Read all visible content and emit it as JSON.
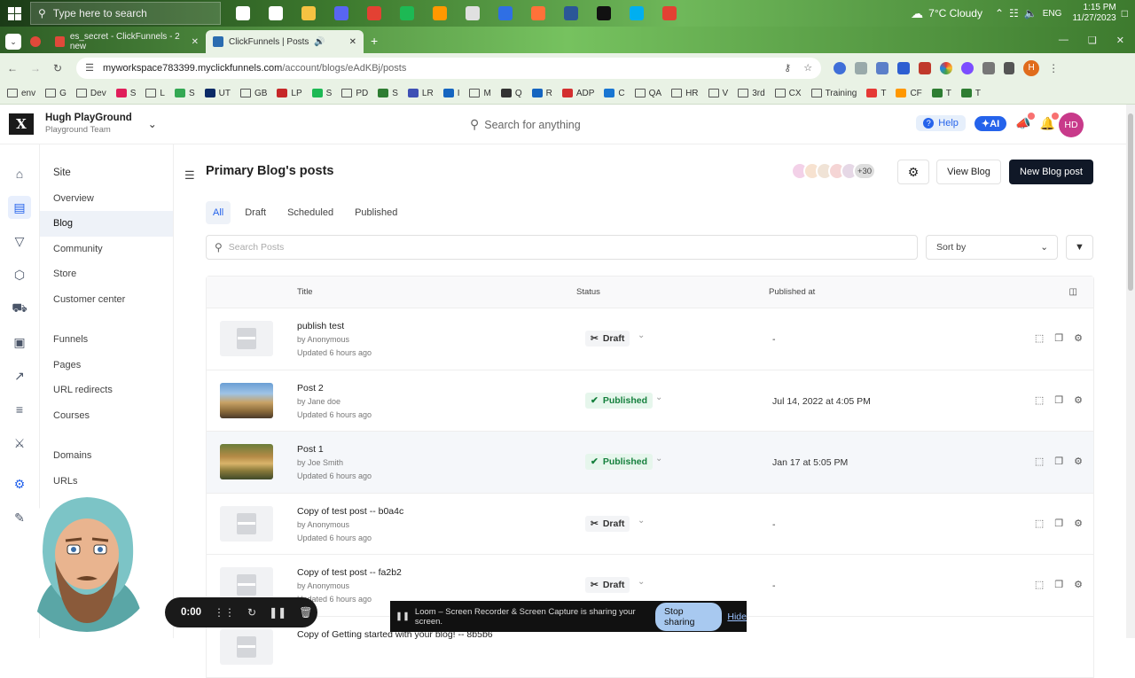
{
  "taskbar": {
    "search_placeholder": "Type here to search",
    "weather": "7°C  Cloudy",
    "lang": "ENG",
    "time": "1:15 PM",
    "date": "11/27/2023",
    "apps": [
      {
        "icon": "task-view-icon",
        "color": "#ffffff"
      },
      {
        "icon": "settings-icon",
        "color": "#ffffff"
      },
      {
        "icon": "file-explorer-icon",
        "color": "#f5c242"
      },
      {
        "icon": "discord-icon",
        "color": "#5865f2"
      },
      {
        "icon": "chrome-icon",
        "color": "#e34133"
      },
      {
        "icon": "spotify-icon",
        "color": "#1db954"
      },
      {
        "icon": "sublime-icon",
        "color": "#ff9800"
      },
      {
        "icon": "notepad-icon",
        "color": "#e0e0e0"
      },
      {
        "icon": "vpn-icon",
        "color": "#2f6fe4"
      },
      {
        "icon": "firefox-icon",
        "color": "#ff7139"
      },
      {
        "icon": "powershell-icon",
        "color": "#2b5797"
      },
      {
        "icon": "terminal-icon",
        "color": "#111111"
      },
      {
        "icon": "skype-icon",
        "color": "#00aff0"
      },
      {
        "icon": "chrome-profile-icon",
        "color": "#e34133"
      }
    ]
  },
  "browser": {
    "tabs": [
      {
        "label": "es_secret - ClickFunnels - 2 new",
        "color": "#e0493a",
        "active": false
      },
      {
        "label": "ClickFunnels | Posts",
        "color": "#2b6cb0",
        "active": true
      }
    ],
    "url_host": "myworkspace783399.myclickfunnels.com",
    "url_path": "/account/blogs/eAdKBj/posts",
    "profile_initial": "H",
    "bookmarks": [
      {
        "label": "env",
        "color": ""
      },
      {
        "label": "G",
        "color": ""
      },
      {
        "label": "Dev",
        "color": ""
      },
      {
        "label": "S",
        "color": "#e01e5a"
      },
      {
        "label": "L",
        "color": ""
      },
      {
        "label": "S",
        "color": "#34a853"
      },
      {
        "label": "UT",
        "color": "#0a2a66"
      },
      {
        "label": "GB",
        "color": ""
      },
      {
        "label": "LP",
        "color": "#c62828"
      },
      {
        "label": "S",
        "color": "#1db954"
      },
      {
        "label": "PD",
        "color": ""
      },
      {
        "label": "S",
        "color": "#2e7d32"
      },
      {
        "label": "LR",
        "color": "#3f51b5"
      },
      {
        "label": "I",
        "color": "#1565c0"
      },
      {
        "label": "M",
        "color": ""
      },
      {
        "label": "Q",
        "color": "#333333"
      },
      {
        "label": "R",
        "color": "#1565c0"
      },
      {
        "label": "ADP",
        "color": "#d32f2f"
      },
      {
        "label": "C",
        "color": "#1976d2"
      },
      {
        "label": "QA",
        "color": ""
      },
      {
        "label": "HR",
        "color": ""
      },
      {
        "label": "V",
        "color": ""
      },
      {
        "label": "3rd",
        "color": ""
      },
      {
        "label": "CX",
        "color": ""
      },
      {
        "label": "Training",
        "color": ""
      },
      {
        "label": "T",
        "color": "#e53935"
      },
      {
        "label": "CF",
        "color": "#ff9800"
      },
      {
        "label": "T",
        "color": "#2e7d32"
      },
      {
        "label": "T",
        "color": "#2e7d32"
      }
    ]
  },
  "app": {
    "workspace_name": "Hugh PlayGround",
    "workspace_team": "Playground Team",
    "search_placeholder": "Search for anything",
    "help_label": "Help",
    "ai_label": "AI",
    "user_initials": "HD",
    "accent": "#2563eb",
    "rail_icons": [
      "home-icon",
      "websites-icon",
      "funnels-icon",
      "products-icon",
      "orders-icon",
      "contacts-icon",
      "analytics-icon",
      "automations-icon",
      "courses-icon",
      "settings-icon",
      "edit-icon"
    ],
    "nav": [
      {
        "label": "Site",
        "type": "head"
      },
      {
        "label": "Overview",
        "type": "item"
      },
      {
        "label": "Blog",
        "type": "active"
      },
      {
        "label": "Community",
        "type": "item"
      },
      {
        "label": "Store",
        "type": "item"
      },
      {
        "label": "Customer center",
        "type": "item"
      },
      {
        "label": "",
        "type": "gap"
      },
      {
        "label": "Funnels",
        "type": "item"
      },
      {
        "label": "Pages",
        "type": "item"
      },
      {
        "label": "URL redirects",
        "type": "item"
      },
      {
        "label": "Courses",
        "type": "item"
      },
      {
        "label": "",
        "type": "gap"
      },
      {
        "label": "Domains",
        "type": "item"
      },
      {
        "label": "URLs",
        "type": "item"
      }
    ]
  },
  "page": {
    "title": "Primary Blog's posts",
    "collaborators_more": "+30",
    "view_blog_label": "View Blog",
    "new_post_label": "New Blog post",
    "filter_tabs": [
      {
        "label": "All",
        "active": true
      },
      {
        "label": "Draft",
        "active": false
      },
      {
        "label": "Scheduled",
        "active": false
      },
      {
        "label": "Published",
        "active": false
      }
    ],
    "search_placeholder": "Search Posts",
    "sort_label": "Sort by",
    "columns": {
      "title": "Title",
      "status": "Status",
      "published_at": "Published at"
    },
    "posts": [
      {
        "title": "publish test",
        "author": "by Anonymous",
        "updated": "Updated 6 hours ago",
        "status": "Draft",
        "published_at": "-",
        "thumb": "placeholder"
      },
      {
        "title": "Post 2",
        "author": "by Jane doe",
        "updated": "Updated 6 hours ago",
        "status": "Published",
        "published_at": "Jul 14, 2022 at 4:05 PM",
        "thumb": "photo-columns"
      },
      {
        "title": "Post 1",
        "author": "by Joe Smith",
        "updated": "Updated 6 hours ago",
        "status": "Published",
        "published_at": "Jan 17 at 5:05 PM",
        "thumb": "photo-forest"
      },
      {
        "title": "Copy of test post -- b0a4c",
        "author": "by Anonymous",
        "updated": "Updated 6 hours ago",
        "status": "Draft",
        "published_at": "-",
        "thumb": "placeholder"
      },
      {
        "title": "Copy of test post -- fa2b2",
        "author": "by Anonymous",
        "updated": "Updated 6 hours ago",
        "status": "Draft",
        "published_at": "-",
        "thumb": "placeholder"
      },
      {
        "title": "Copy of Getting started with your blog! -- 8b5b6",
        "author": "",
        "updated": "",
        "status": "",
        "published_at": "",
        "thumb": "placeholder"
      }
    ]
  },
  "recorder": {
    "timer": "0:00",
    "share_message": "Loom – Screen Recorder & Screen Capture is sharing your screen.",
    "stop_label": "Stop sharing",
    "hide_label": "Hide"
  }
}
